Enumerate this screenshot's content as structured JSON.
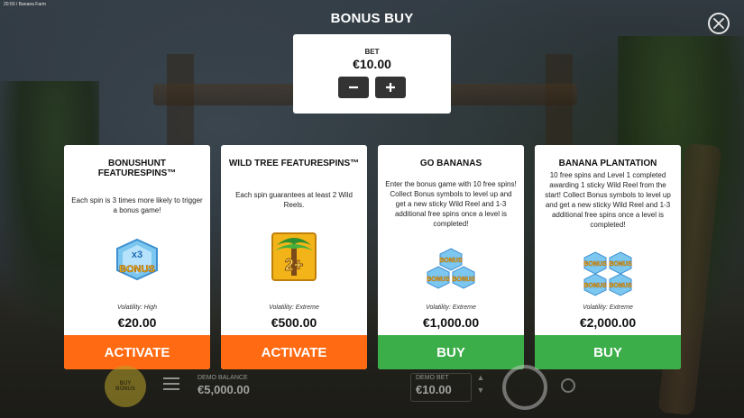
{
  "status_bar": {
    "text": "20:50 / Banana Farm"
  },
  "header": {
    "title": "BONUS BUY"
  },
  "bet": {
    "label": "BET",
    "value": "€10.00",
    "minus_icon": "minus-icon",
    "plus_icon": "plus-icon"
  },
  "cards": [
    {
      "title": "BONUSHUNT FEATURESPINS™",
      "description": "Each spin is 3 times more likely to trigger a bonus game!",
      "icon_text_top": "x3",
      "icon_text_bottom": "BONUS",
      "volatility": "Volatility: High",
      "price": "€20.00",
      "action": "ACTIVATE",
      "action_color": "#ff6a13"
    },
    {
      "title": "WILD TREE FEATURESPINS™",
      "description": "Each spin guarantees at least 2 Wild Reels.",
      "icon_text": "2+",
      "volatility": "Volatility: Extreme",
      "price": "€500.00",
      "action": "ACTIVATE",
      "action_color": "#ff6a13"
    },
    {
      "title": "GO BANANAS",
      "description": "Enter the bonus game with 10 free spins! Collect Bonus symbols to level up and get a new sticky Wild Reel and 1-3 additional free spins once a level is completed!",
      "icon_text": "BONUS",
      "volatility": "Volatility: Extreme",
      "price": "€1,000.00",
      "action": "BUY",
      "action_color": "#3cae49"
    },
    {
      "title": "BANANA PLANTATION",
      "description": "10 free spins and Level 1 completed awarding 1 sticky Wild Reel from the start! Collect Bonus symbols to level up and get a new sticky Wild Reel and 1-3 additional free spins once a level is completed!",
      "icon_text": "BONUS",
      "volatility": "Volatility: Extreme",
      "price": "€2,000.00",
      "action": "BUY",
      "action_color": "#3cae49"
    }
  ],
  "footer": {
    "buy_bonus_line1": "BUY",
    "buy_bonus_line2": "BONUS",
    "demo_balance_label": "DEMO BALANCE",
    "demo_balance_value": "€5,000.00",
    "demo_bet_label": "DEMO BET",
    "demo_bet_value": "€10.00"
  },
  "colors": {
    "activate": "#ff6a13",
    "buy": "#3cae49",
    "card_bg": "#ffffff"
  }
}
